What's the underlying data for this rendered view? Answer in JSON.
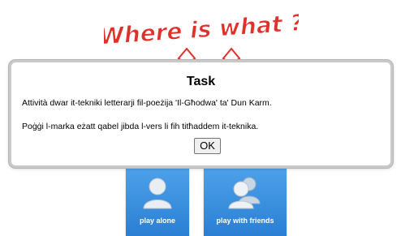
{
  "logo": {
    "text": "Where is what ?",
    "color": "#e0302a"
  },
  "dialog": {
    "title": "Task",
    "line1": "Attività dwar it-tekniki letterarji fil-poeżija 'Il-Għodwa' ta' Dun Karm.",
    "line2": "Poġġi l-marka eżatt qabel jibda l-vers li fih titħaddem it-teknika.",
    "ok_label": "OK"
  },
  "tiles": {
    "alone": {
      "label": "play alone",
      "icon": "single-user-icon"
    },
    "friends": {
      "label": "play with friends",
      "icon": "multi-user-icon"
    }
  },
  "colors": {
    "tile_top": "#4fa3ea",
    "tile_bottom": "#2a7fd4",
    "dialog_border": "#c9c9c9"
  }
}
